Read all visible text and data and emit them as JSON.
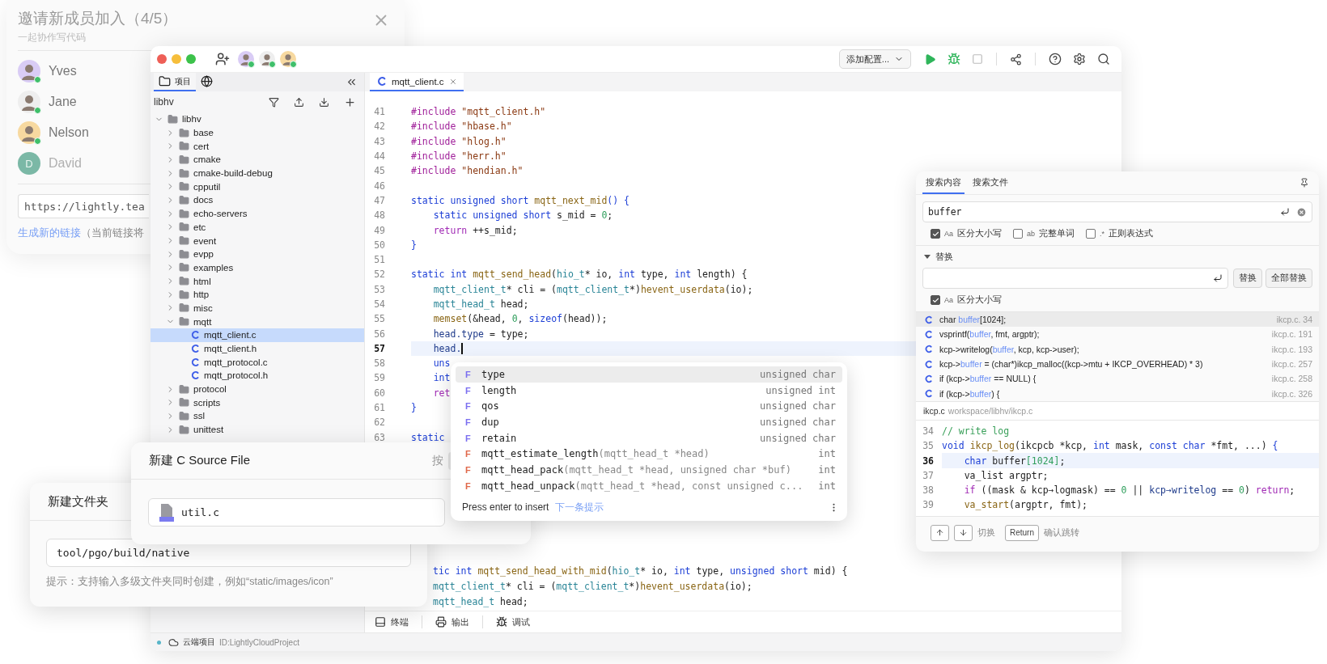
{
  "invite": {
    "title": "邀请新成员加入（4/5）",
    "subtitle": "一起协作写代码",
    "members": [
      {
        "name": "Yves",
        "kind": "avatar",
        "online": true
      },
      {
        "name": "Jane",
        "kind": "avatar",
        "online": true
      },
      {
        "name": "Nelson",
        "kind": "avatar",
        "online": true
      },
      {
        "name": "David",
        "kind": "initial",
        "initial": "D",
        "online": false
      }
    ],
    "link": "https://lightly.tea",
    "regenerate": "生成新的链接",
    "regenerate_note": "（当前链接将"
  },
  "ide": {
    "collaborators": [
      {
        "online": true
      },
      {
        "online": true
      },
      {
        "online": true
      }
    ],
    "run_config": "添加配置...",
    "sidebar_tabs": [
      {
        "kind": "project",
        "label": "项目",
        "selected": true
      },
      {
        "kind": "web",
        "selected": false
      }
    ],
    "root_label": "libhv",
    "tree": [
      {
        "name": "libhv",
        "kind": "folder",
        "expanded": true,
        "selected": false,
        "children": [
          {
            "name": "base",
            "kind": "folder",
            "expanded": false,
            "selected": false
          },
          {
            "name": "cert",
            "kind": "folder",
            "expanded": false,
            "selected": false
          },
          {
            "name": "cmake",
            "kind": "folder",
            "expanded": false,
            "selected": false
          },
          {
            "name": "cmake-build-debug",
            "kind": "folder",
            "expanded": false,
            "selected": false
          },
          {
            "name": "cpputil",
            "kind": "folder",
            "expanded": false,
            "selected": false
          },
          {
            "name": "docs",
            "kind": "folder",
            "expanded": false,
            "selected": false
          },
          {
            "name": "echo-servers",
            "kind": "folder",
            "expanded": false,
            "selected": false
          },
          {
            "name": "etc",
            "kind": "folder",
            "expanded": false,
            "selected": false
          },
          {
            "name": "event",
            "kind": "folder",
            "expanded": false,
            "selected": false
          },
          {
            "name": "evpp",
            "kind": "folder",
            "expanded": false,
            "selected": false
          },
          {
            "name": "examples",
            "kind": "folder",
            "expanded": false,
            "selected": false
          },
          {
            "name": "html",
            "kind": "folder",
            "expanded": false,
            "selected": false
          },
          {
            "name": "http",
            "kind": "folder",
            "expanded": false,
            "selected": false
          },
          {
            "name": "misc",
            "kind": "folder",
            "expanded": false,
            "selected": false
          },
          {
            "name": "mqtt",
            "kind": "folder",
            "expanded": true,
            "selected": false,
            "children": [
              {
                "name": "mqtt_client.c",
                "kind": "c_file",
                "selected": true
              },
              {
                "name": "mqtt_client.h",
                "kind": "c_file",
                "selected": false
              },
              {
                "name": "mqtt_protocol.c",
                "kind": "c_file",
                "selected": false
              },
              {
                "name": "mqtt_protocol.h",
                "kind": "c_file",
                "selected": false
              }
            ]
          },
          {
            "name": "protocol",
            "kind": "folder",
            "expanded": false,
            "selected": false
          },
          {
            "name": "scripts",
            "kind": "folder",
            "expanded": false,
            "selected": false
          },
          {
            "name": "ssl",
            "kind": "folder",
            "expanded": false,
            "selected": false
          },
          {
            "name": "unittest",
            "kind": "folder",
            "expanded": false,
            "selected": false
          }
        ]
      }
    ],
    "editor_tabs": [
      {
        "label": "mqtt_client.c",
        "selected": true
      }
    ],
    "lines": [
      {
        "num": "41",
        "current": false,
        "tokens": [
          {
            "kind": "pp",
            "text": "#include "
          },
          {
            "kind": "str",
            "text": "\"mqtt_client.h\""
          }
        ]
      },
      {
        "num": "42",
        "current": false,
        "tokens": [
          {
            "kind": "pp",
            "text": "#include "
          },
          {
            "kind": "str",
            "text": "\"hbase.h\""
          }
        ]
      },
      {
        "num": "43",
        "current": false,
        "tokens": [
          {
            "kind": "pp",
            "text": "#include "
          },
          {
            "kind": "str",
            "text": "\"hlog.h\""
          }
        ]
      },
      {
        "num": "44",
        "current": false,
        "tokens": [
          {
            "kind": "pp",
            "text": "#include "
          },
          {
            "kind": "str",
            "text": "\"herr.h\""
          }
        ]
      },
      {
        "num": "45",
        "current": false,
        "tokens": [
          {
            "kind": "pp",
            "text": "#include "
          },
          {
            "kind": "str",
            "text": "\"hendian.h\""
          }
        ]
      },
      {
        "num": "46",
        "current": false
      },
      {
        "num": "47",
        "current": false,
        "tokens": [
          {
            "kind": "kw",
            "text": "static unsigned short "
          },
          {
            "kind": "fn",
            "text": "mqtt_next_mid"
          },
          {
            "kind": "kw",
            "text": "() {"
          }
        ]
      },
      {
        "num": "48",
        "current": false,
        "tokens": [
          {
            "kind": "kw",
            "text": "    static unsigned short "
          },
          {
            "kind": "id",
            "text": "s_mid = "
          },
          {
            "kind": "num",
            "text": "0"
          },
          {
            "kind": "id",
            "text": ";"
          }
        ]
      },
      {
        "num": "49",
        "current": false,
        "tokens": [
          {
            "kind": "ret",
            "text": "    return "
          },
          {
            "kind": "id",
            "text": "++s_mid;"
          }
        ]
      },
      {
        "num": "50",
        "current": false,
        "tokens": [
          {
            "kind": "kw",
            "text": "}"
          }
        ]
      },
      {
        "num": "51",
        "current": false
      },
      {
        "num": "52",
        "current": false,
        "tokens": [
          {
            "kind": "kw",
            "text": "static int "
          },
          {
            "kind": "fn",
            "text": "mqtt_send_head"
          },
          {
            "kind": "id",
            "text": "("
          },
          {
            "kind": "ty",
            "text": "hio_t"
          },
          {
            "kind": "id",
            "text": "* io, "
          },
          {
            "kind": "kw",
            "text": "int "
          },
          {
            "kind": "id",
            "text": "type, "
          },
          {
            "kind": "kw",
            "text": "int "
          },
          {
            "kind": "id",
            "text": "length) {"
          }
        ]
      },
      {
        "num": "53",
        "current": false,
        "tokens": [
          {
            "kind": "ty",
            "text": "    mqtt_client_t"
          },
          {
            "kind": "id",
            "text": "* cli = ("
          },
          {
            "kind": "ty",
            "text": "mqtt_client_t"
          },
          {
            "kind": "id",
            "text": "*)"
          },
          {
            "kind": "fn",
            "text": "hevent_userdata"
          },
          {
            "kind": "id",
            "text": "(io);"
          }
        ]
      },
      {
        "num": "54",
        "current": false,
        "tokens": [
          {
            "kind": "ty",
            "text": "    mqtt_head_t"
          },
          {
            "kind": "id",
            "text": " head;"
          }
        ]
      },
      {
        "num": "55",
        "current": false,
        "tokens": [
          {
            "kind": "fn",
            "text": "    memset"
          },
          {
            "kind": "id",
            "text": "(&head, "
          },
          {
            "kind": "num",
            "text": "0"
          },
          {
            "kind": "id",
            "text": ", "
          },
          {
            "kind": "kw",
            "text": "sizeof"
          },
          {
            "kind": "id",
            "text": "(head));"
          }
        ]
      },
      {
        "num": "56",
        "current": false,
        "tokens": [
          {
            "kind": "fld",
            "text": "    head.type"
          },
          {
            "kind": "id",
            "text": " = type;"
          }
        ]
      },
      {
        "num": "57",
        "current": true,
        "tokens": [
          {
            "kind": "fld",
            "text": "    head."
          }
        ]
      },
      {
        "num": "58",
        "current": false,
        "tokens": [
          {
            "kind": "kw",
            "text": "    uns"
          }
        ]
      },
      {
        "num": "59",
        "current": false,
        "tokens": [
          {
            "kind": "kw",
            "text": "    int"
          }
        ]
      },
      {
        "num": "60",
        "current": false,
        "tokens": [
          {
            "kind": "ret",
            "text": "    ret"
          }
        ]
      },
      {
        "num": "61",
        "current": false,
        "tokens": [
          {
            "kind": "kw",
            "text": "}"
          }
        ]
      },
      {
        "num": "62",
        "current": false
      },
      {
        "num": "63",
        "current": false,
        "tokens": [
          {
            "kind": "kw",
            "text": "static"
          }
        ]
      }
    ],
    "tail_lines": [
      [
        {
          "kind": "kw",
          "text": "tic int "
        },
        {
          "kind": "fn",
          "text": "mqtt_send_head_with_mid"
        },
        {
          "kind": "id",
          "text": "("
        },
        {
          "kind": "ty",
          "text": "hio_t"
        },
        {
          "kind": "id",
          "text": "* io, "
        },
        {
          "kind": "kw",
          "text": "int "
        },
        {
          "kind": "id",
          "text": "type, "
        },
        {
          "kind": "kw",
          "text": "unsigned short "
        },
        {
          "kind": "id",
          "text": "mid) {"
        }
      ],
      [
        {
          "kind": "ty",
          "text": "mqtt_client_t"
        },
        {
          "kind": "id",
          "text": "* cli = ("
        },
        {
          "kind": "ty",
          "text": "mqtt_client_t"
        },
        {
          "kind": "id",
          "text": "*)"
        },
        {
          "kind": "fn",
          "text": "hevent_userdata"
        },
        {
          "kind": "id",
          "text": "(io);"
        }
      ],
      [
        {
          "kind": "ty",
          "text": "mqtt_head_t"
        },
        {
          "kind": "id",
          "text": " head;"
        }
      ]
    ],
    "bottom_tabs": [
      {
        "kind": "terminal",
        "label": "终端"
      },
      {
        "kind": "output",
        "label": "输出"
      },
      {
        "kind": "debug",
        "label": "调试"
      }
    ],
    "status": {
      "label": "云端项目",
      "project_id": "ID:LightlyCloudProject"
    }
  },
  "autocomplete": {
    "items": [
      {
        "kind": "field",
        "badge": "F",
        "name": "type",
        "type": "unsigned char",
        "selected": true
      },
      {
        "kind": "field",
        "badge": "F",
        "name": "length",
        "type": "unsigned int",
        "selected": false
      },
      {
        "kind": "field",
        "badge": "F",
        "name": "qos",
        "type": "unsigned char",
        "selected": false
      },
      {
        "kind": "field",
        "badge": "F",
        "name": "dup",
        "type": "unsigned char",
        "selected": false
      },
      {
        "kind": "field",
        "badge": "F",
        "name": "retain",
        "type": "unsigned char",
        "selected": false
      },
      {
        "kind": "function",
        "badge": "F",
        "name": "mqtt_estimate_length",
        "params": "(mqtt_head_t *head)",
        "type": "int",
        "selected": false
      },
      {
        "kind": "function",
        "badge": "F",
        "name": "mqtt_head_pack",
        "params": "(mqtt_head_t *head, unsigned char *buf)",
        "type": "int",
        "selected": false
      },
      {
        "kind": "function",
        "badge": "F",
        "name": "mqtt_head_unpack",
        "params": "(mqtt_head_t *head, const unsigned c...",
        "type": "int",
        "selected": false
      }
    ],
    "hint": "Press enter to insert",
    "next_hint": "下一条提示"
  },
  "search": {
    "tabs": [
      {
        "label": "搜索内容",
        "selected": true
      },
      {
        "label": "搜索文件",
        "selected": false
      }
    ],
    "query": "buffer",
    "options": [
      {
        "glyph": "Aa",
        "label": "区分大小写",
        "checked": true
      },
      {
        "glyph": "ab",
        "label": "完整单词",
        "checked": false
      },
      {
        "glyph": ".*",
        "label": "正则表达式",
        "checked": false
      }
    ],
    "replace": {
      "title": "替换",
      "expanded": true,
      "buttons": [
        "替换",
        "全部替换"
      ],
      "options": [
        {
          "glyph": "Aa",
          "label": "区分大小写",
          "checked": true
        }
      ]
    },
    "results": [
      {
        "pre": "char ",
        "match": "buffer",
        "post": "[1024];",
        "location": "ikcp.c. 34",
        "selected": true
      },
      {
        "pre": "vsprintf(",
        "match": "buffer",
        "post": ", fmt, argptr);",
        "location": "ikcp.c. 191",
        "selected": false
      },
      {
        "pre": "kcp->writelog(",
        "match": "buffer",
        "post": ", kcp, kcp->user);",
        "location": "ikcp.c. 193",
        "selected": false
      },
      {
        "pre": "kcp->",
        "match": "buffer",
        "post": " = (char*)ikcp_malloc((kcp->mtu + IKCP_OVERHEAD) * 3)",
        "location": "ikcp.c. 257",
        "selected": false
      },
      {
        "pre": "if (kcp->",
        "match": "buffer",
        "post": " == NULL) {",
        "location": "ikcp.c. 258",
        "selected": false
      },
      {
        "pre": "if (kcp->",
        "match": "buffer",
        "post": ") {",
        "location": "ikcp.c. 326",
        "selected": false
      }
    ],
    "file": {
      "name": "ikcp.c",
      "path": "workspace/libhv/ikcp.c"
    },
    "preview": [
      {
        "num": "34",
        "current": false,
        "tokens": [
          {
            "kind": "cm",
            "text": "// write log"
          }
        ]
      },
      {
        "num": "35",
        "current": false,
        "tokens": [
          {
            "kind": "kw",
            "text": "void "
          },
          {
            "kind": "fn",
            "text": "ikcp_log"
          },
          {
            "kind": "id",
            "text": "(ikcpcb *kcp, "
          },
          {
            "kind": "kw",
            "text": "int "
          },
          {
            "kind": "id",
            "text": "mask, "
          },
          {
            "kind": "kw",
            "text": "const char "
          },
          {
            "kind": "id",
            "text": "*fmt, ...) "
          },
          {
            "kind": "kw",
            "text": "{"
          }
        ]
      },
      {
        "num": "36",
        "current": true,
        "tokens": [
          {
            "kind": "kw",
            "text": "    char "
          },
          {
            "kind": "id",
            "text": "buffer"
          },
          {
            "kind": "num",
            "text": "[1024]"
          },
          {
            "kind": "id",
            "text": ";"
          }
        ]
      },
      {
        "num": "37",
        "current": false,
        "tokens": [
          {
            "kind": "id",
            "text": "    va_list argptr;"
          }
        ]
      },
      {
        "num": "38",
        "current": false,
        "tokens": [
          {
            "kind": "ret",
            "text": "    if "
          },
          {
            "kind": "id",
            "text": "((mask & kcp→logmask) == "
          },
          {
            "kind": "num",
            "text": "0"
          },
          {
            "kind": "id",
            "text": " || "
          },
          {
            "kind": "fld",
            "text": "kcp→writelog"
          },
          {
            "kind": "id",
            "text": " == "
          },
          {
            "kind": "num",
            "text": "0"
          },
          {
            "kind": "id",
            "text": ") "
          },
          {
            "kind": "ret",
            "text": "return"
          },
          {
            "kind": "id",
            "text": ";"
          }
        ]
      },
      {
        "num": "39",
        "current": false,
        "tokens": [
          {
            "kind": "fn",
            "text": "    va_start"
          },
          {
            "kind": "id",
            "text": "(argptr, fmt);"
          }
        ]
      }
    ],
    "footer": {
      "switch_label": "切换",
      "confirm_key": "Return",
      "confirm_label": "确认跳转"
    }
  },
  "new_file_dialog": {
    "title": "新建 C Source File",
    "shortcut_hint": "按",
    "value": "util.c"
  },
  "new_folder_dialog": {
    "title": "新建文件夹",
    "value": "tool/pgo/build/native",
    "hint": "提示：支持输入多级文件夹同时创建，例如“static/images/icon”"
  }
}
